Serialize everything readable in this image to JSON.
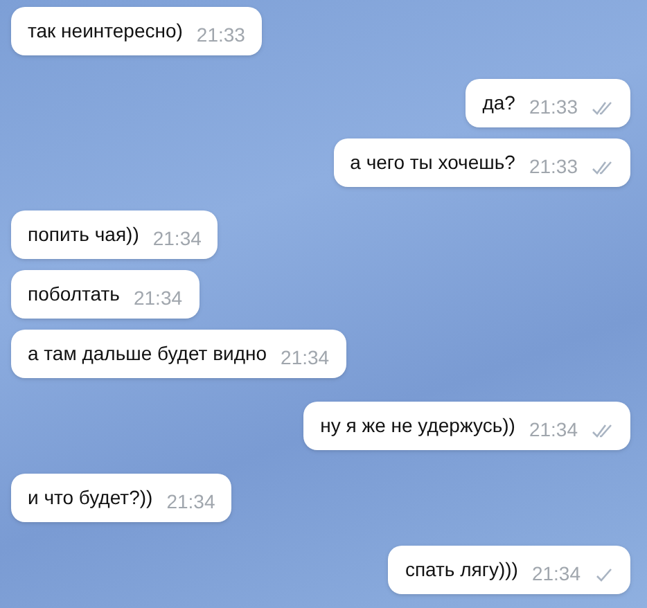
{
  "messages": [
    {
      "kind": "in",
      "text": "так неинтересно)",
      "time": "21:33"
    },
    {
      "kind": "out",
      "text": "да?",
      "time": "21:33",
      "read": true
    },
    {
      "kind": "out",
      "text": "а чего ты хочешь?",
      "time": "21:33",
      "read": true
    },
    {
      "kind": "in",
      "text": "попить чая))",
      "time": "21:34"
    },
    {
      "kind": "in",
      "text": "поболтать",
      "time": "21:34"
    },
    {
      "kind": "in",
      "text": "а там дальше будет видно",
      "time": "21:34"
    },
    {
      "kind": "out",
      "text": "ну я же не удержусь))",
      "time": "21:34",
      "read": true
    },
    {
      "kind": "in",
      "text": "и что будет?))",
      "time": "21:34"
    },
    {
      "kind": "out",
      "text": "спать лягу)))",
      "time": "21:34",
      "read": false
    }
  ]
}
